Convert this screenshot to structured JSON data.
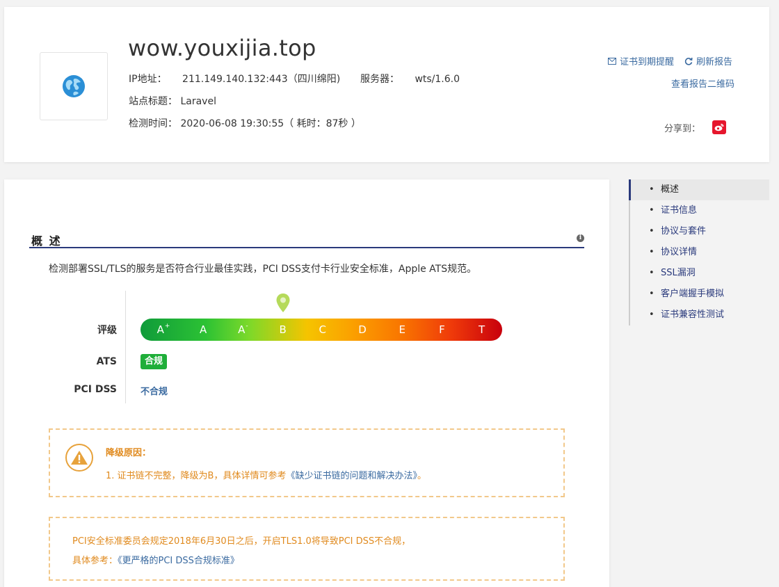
{
  "header": {
    "domain": "wow.youxijia.top",
    "ip_label": "IP地址：",
    "ip_value": "211.149.140.132:443（四川绵阳)",
    "server_label": "服务器：",
    "server_value": "wts/1.6.0",
    "title_label": "站点标题：",
    "title_value": "Laravel",
    "time_label": "检测时间：",
    "time_value": "2020-06-08 19:30:55（ 耗时：87秒 ）",
    "actions": {
      "expiry_reminder": "证书到期提醒",
      "refresh_report": "刷新报告",
      "report_qr": "查看报告二维码"
    },
    "share_label": "分享到："
  },
  "overview": {
    "title": "概 述",
    "description": "检测部署SSL/TLS的服务是否符合行业最佳实践，PCI DSS支付卡行业安全标准，Apple ATS规范。",
    "grade_label": "评级",
    "grades": [
      "A+",
      "A",
      "A-",
      "B",
      "C",
      "D",
      "E",
      "F",
      "T"
    ],
    "current_grade": "B",
    "ats_label": "ATS",
    "ats_value": "合规",
    "pci_label": "PCI DSS",
    "pci_value": "不合规",
    "downgrade": {
      "title": "降级原因：",
      "text": "1. 证书链不完整，降级为B，具体详情可参考",
      "link": "《缺少证书链的问题和解决办法》",
      "suffix": "。"
    },
    "pci_notice": {
      "line1": "PCI安全标准委员会规定2018年6月30日之后，开启TLS1.0将导致PCI DSS不合规，",
      "line2_label": "具体参考：",
      "line2_link": "《更严格的PCI DSS合规标准》"
    }
  },
  "side_nav": {
    "items": [
      "概述",
      "证书信息",
      "协议与套件",
      "协议详情",
      "SSL漏洞",
      "客户端握手模拟",
      "证书兼容性测试"
    ],
    "active_index": 0
  },
  "colors": {
    "accent": "#2a3a7c",
    "link": "#3a6aa0",
    "warning": "#e08a1e",
    "ats_green": "#1fae39",
    "weibo_red": "#e6162d"
  }
}
